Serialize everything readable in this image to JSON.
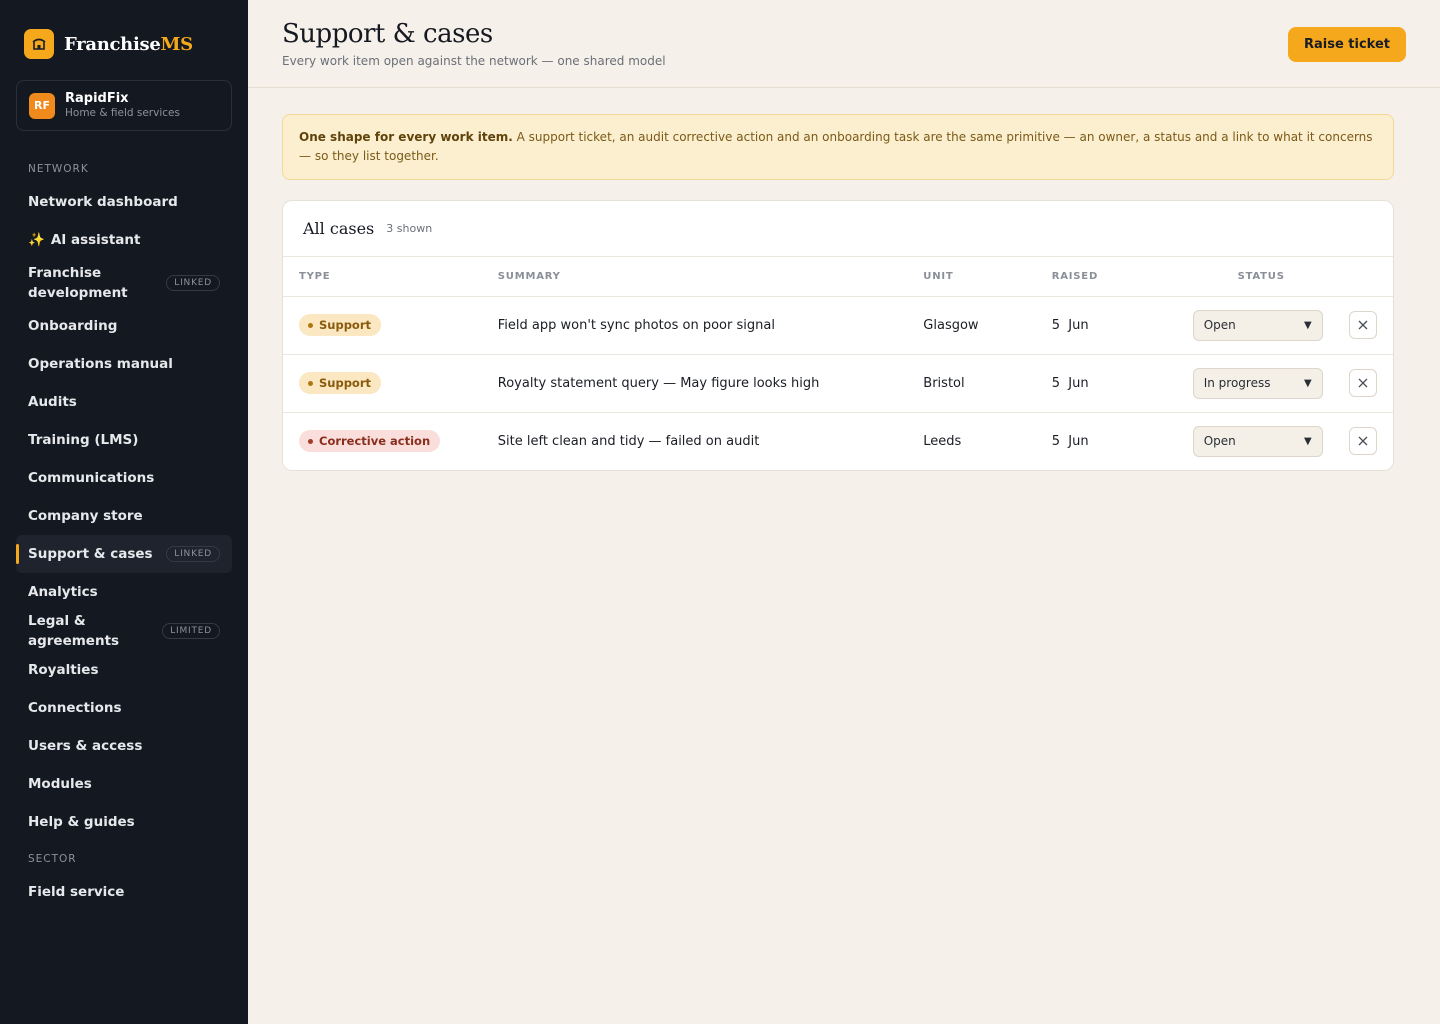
{
  "brand": {
    "name_main": "Franchise",
    "name_accent": "MS"
  },
  "org": {
    "initials": "RF",
    "name": "RapidFix",
    "subtitle": "Home & field services"
  },
  "sidebar": {
    "network_label": "NETWORK",
    "items": [
      {
        "label": "Network dashboard",
        "badge": ""
      },
      {
        "label": "AI assistant",
        "badge": "",
        "icon": "sparkles-icon"
      },
      {
        "label": "Franchise development",
        "badge": "LINKED"
      },
      {
        "label": "Onboarding",
        "badge": ""
      },
      {
        "label": "Operations manual",
        "badge": ""
      },
      {
        "label": "Audits",
        "badge": ""
      },
      {
        "label": "Training (LMS)",
        "badge": ""
      },
      {
        "label": "Communications",
        "badge": ""
      },
      {
        "label": "Company store",
        "badge": ""
      },
      {
        "label": "Support & cases",
        "badge": "LINKED",
        "active": true
      },
      {
        "label": "Analytics",
        "badge": ""
      },
      {
        "label": "Legal & agreements",
        "badge": "LIMITED"
      },
      {
        "label": "Royalties",
        "badge": ""
      },
      {
        "label": "Connections",
        "badge": ""
      },
      {
        "label": "Users & access",
        "badge": ""
      },
      {
        "label": "Modules",
        "badge": ""
      },
      {
        "label": "Help & guides",
        "badge": ""
      }
    ],
    "sector_label": "SECTOR",
    "sector_items": [
      {
        "label": "Field service"
      }
    ]
  },
  "header": {
    "title": "Support & cases",
    "subtitle": "Every work item open against the network — one shared model",
    "raise_button": "Raise ticket"
  },
  "notice": {
    "bold": "One shape for every work item.",
    "text": " A support ticket, an audit corrective action and an onboarding task are the same primitive — an owner, a status and a link to what it concerns — so they list together."
  },
  "cases": {
    "title": "All cases",
    "count": "3 shown",
    "columns": {
      "type": "TYPE",
      "summary": "SUMMARY",
      "unit": "UNIT",
      "raised": "RAISED",
      "status": "STATUS"
    },
    "rows": [
      {
        "type": "Support",
        "type_kind": "support",
        "summary": "Field app won't sync photos on poor signal",
        "unit": "Glasgow",
        "raised": "5  Jun",
        "status": "Open"
      },
      {
        "type": "Support",
        "type_kind": "support",
        "summary": "Royalty statement query — May figure looks high",
        "unit": "Bristol",
        "raised": "5  Jun",
        "status": "In progress"
      },
      {
        "type": "Corrective action",
        "type_kind": "corrective",
        "summary": "Site left clean and tidy — failed on audit",
        "unit": "Leeds",
        "raised": "5  Jun",
        "status": "Open"
      }
    ]
  },
  "colors": {
    "accent": "#f5a81c",
    "sidebar_bg": "#141820",
    "page_bg": "#f5f1ea"
  }
}
